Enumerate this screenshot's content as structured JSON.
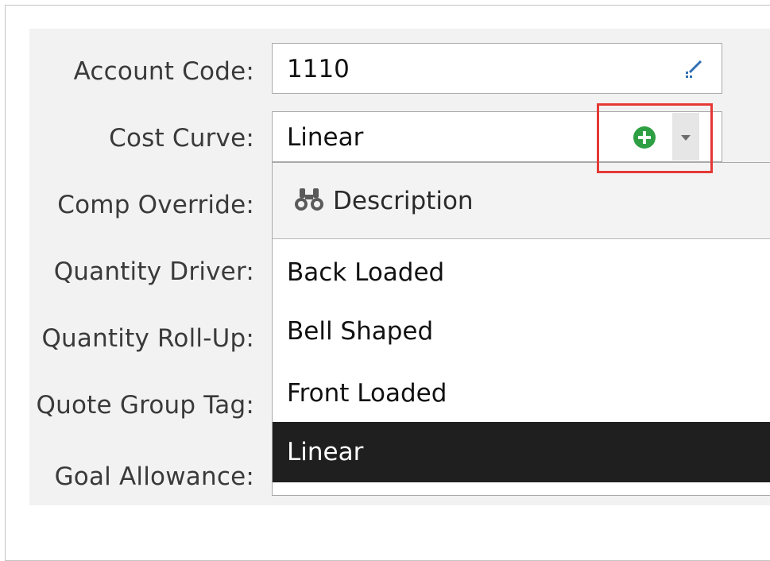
{
  "form": {
    "labels": {
      "account_code": "Account Code:",
      "cost_curve": "Cost Curve:",
      "comp_override": "Comp Override:",
      "quantity_driver": "Quantity Driver:",
      "quantity_rollup": "Quantity Roll-Up:",
      "quote_group_tag": "Quote Group Tag:",
      "goal_allowance": "Goal Allowance:"
    },
    "account_code_value": "1110",
    "cost_curve_value": "Linear"
  },
  "dropdown": {
    "header": "Description",
    "options": [
      {
        "label": "Back Loaded",
        "selected": false
      },
      {
        "label": "Bell Shaped",
        "selected": false
      },
      {
        "label": "Front Loaded",
        "selected": false
      },
      {
        "label": "Linear",
        "selected": true
      }
    ]
  },
  "icons": {
    "edit": "edit-pencil-icon",
    "add": "plus-circle-icon",
    "dropdown": "chevron-down-icon",
    "search": "binoculars-icon"
  },
  "colors": {
    "add_icon": "#2ea043",
    "highlight_box": "#e53935",
    "selected_row": "#1f1f1f"
  }
}
